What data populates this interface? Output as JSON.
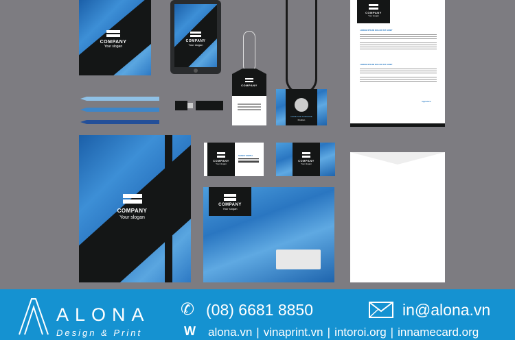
{
  "brand": {
    "company": "COMPANY",
    "slogan": "Your slogan"
  },
  "letterhead": {
    "heading_1": "LOREM IPSUM DOLOR SIT AMET",
    "heading_2": "LOREM IPSUM DOLOR SIT AMET",
    "signature": "signature"
  },
  "badge": {
    "name": "NAME AND SURNAME",
    "position": "Position"
  },
  "card": {
    "name": "SANDY SMITH"
  },
  "banner": {
    "logo_name": "ALONA",
    "logo_tagline": "Design & Print",
    "phone": "(08) 6681 8850",
    "email": "in@alona.vn",
    "web_prefix": "W",
    "websites": [
      "alona.vn",
      "vinaprint.vn",
      "intoroi.org",
      "innamecard.org"
    ],
    "color": "#1592d1"
  }
}
